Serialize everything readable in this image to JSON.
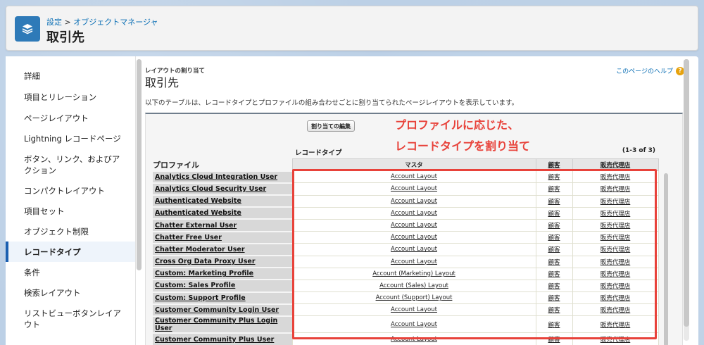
{
  "header": {
    "breadcrumb_setup": "設定",
    "breadcrumb_sep": ">",
    "breadcrumb_object_manager": "オブジェクトマネージャ",
    "title": "取引先",
    "icon": "layers-icon"
  },
  "sidebar": {
    "items": [
      {
        "label": "詳細",
        "active": false
      },
      {
        "label": "項目とリレーション",
        "active": false
      },
      {
        "label": "ページレイアウト",
        "active": false
      },
      {
        "label": "Lightning レコードページ",
        "active": false
      },
      {
        "label": "ボタン、リンク、およびアクション",
        "active": false
      },
      {
        "label": "コンパクトレイアウト",
        "active": false
      },
      {
        "label": "項目セット",
        "active": false
      },
      {
        "label": "オブジェクト制限",
        "active": false
      },
      {
        "label": "レコードタイプ",
        "active": true
      },
      {
        "label": "条件",
        "active": false
      },
      {
        "label": "検索レイアウト",
        "active": false
      },
      {
        "label": "リストビューボタンレイアウト",
        "active": false
      }
    ]
  },
  "content": {
    "caption": "レイアウトの割り当て",
    "title": "取引先",
    "help_link": "このページのヘルプ",
    "help_icon": "?",
    "description": "以下のテーブルは、レコードタイプとプロファイルの組み合わせごとに割り当てられたページレイアウトを表示しています。",
    "edit_button": "割り当ての編集",
    "record_type_label": "レコードタイプ",
    "count_label": "(1-3 of 3)",
    "profile_header": "プロファイル",
    "columns": [
      "マスタ",
      "顧客",
      "販売代理店"
    ],
    "rows": [
      {
        "profile": "Analytics Cloud Integration User",
        "master": "Account Layout",
        "customer": "顧客",
        "agent": "販売代理店"
      },
      {
        "profile": "Analytics Cloud Security User",
        "master": "Account Layout",
        "customer": "顧客",
        "agent": "販売代理店"
      },
      {
        "profile": "Authenticated Website",
        "master": "Account Layout",
        "customer": "顧客",
        "agent": "販売代理店"
      },
      {
        "profile": "Authenticated Website",
        "master": "Account Layout",
        "customer": "顧客",
        "agent": "販売代理店"
      },
      {
        "profile": "Chatter External User",
        "master": "Account Layout",
        "customer": "顧客",
        "agent": "販売代理店"
      },
      {
        "profile": "Chatter Free User",
        "master": "Account Layout",
        "customer": "顧客",
        "agent": "販売代理店"
      },
      {
        "profile": "Chatter Moderator User",
        "master": "Account Layout",
        "customer": "顧客",
        "agent": "販売代理店"
      },
      {
        "profile": "Cross Org Data Proxy User",
        "master": "Account Layout",
        "customer": "顧客",
        "agent": "販売代理店"
      },
      {
        "profile": "Custom: Marketing Profile",
        "master": "Account (Marketing) Layout",
        "customer": "顧客",
        "agent": "販売代理店"
      },
      {
        "profile": "Custom: Sales Profile",
        "master": "Account (Sales) Layout",
        "customer": "顧客",
        "agent": "販売代理店"
      },
      {
        "profile": "Custom: Support Profile",
        "master": "Account (Support) Layout",
        "customer": "顧客",
        "agent": "販売代理店"
      },
      {
        "profile": "Customer Community Login User",
        "master": "Account Layout",
        "customer": "顧客",
        "agent": "販売代理店"
      },
      {
        "profile": "Customer Community Plus Login User",
        "master": "Account Layout",
        "customer": "顧客",
        "agent": "販売代理店"
      },
      {
        "profile": "Customer Community Plus User",
        "master": "Account Layout",
        "customer": "顧客",
        "agent": "販売代理店"
      }
    ]
  },
  "annotation": {
    "line1": "プロファイルに応じた、",
    "line2": "レコードタイプを割り当て",
    "color": "#e8423a"
  },
  "colors": {
    "brand_icon": "#2e7ab8",
    "link": "#0b6fb5",
    "active_bar": "#1b5fb0"
  }
}
